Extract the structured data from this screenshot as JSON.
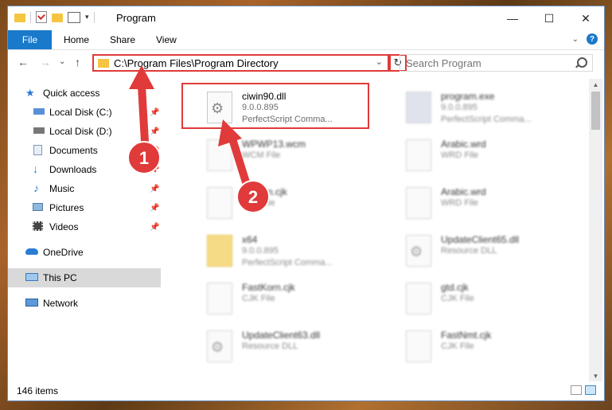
{
  "window": {
    "title": "Program"
  },
  "window_controls": {
    "minimize": "—",
    "maximize": "☐",
    "close": "✕"
  },
  "ribbon": {
    "file": "File",
    "home": "Home",
    "share": "Share",
    "view": "View"
  },
  "nav": {
    "back": "←",
    "forward": "→",
    "recent": "⌄",
    "up": "↑",
    "refresh": "↻",
    "chevron": "⌄"
  },
  "address": {
    "path": "C:\\Program Files\\Program Directory"
  },
  "search": {
    "placeholder": "Search Program"
  },
  "sidebar": {
    "items": [
      {
        "label": "Quick access",
        "icon": "star-icon"
      },
      {
        "label": "Local Disk (C:)",
        "icon": "drive-icon"
      },
      {
        "label": "Local Disk (D:)",
        "icon": "drive-icon"
      },
      {
        "label": "Documents",
        "icon": "documents-icon"
      },
      {
        "label": "Downloads",
        "icon": "downloads-icon"
      },
      {
        "label": "Music",
        "icon": "music-icon"
      },
      {
        "label": "Pictures",
        "icon": "pictures-icon"
      },
      {
        "label": "Videos",
        "icon": "videos-icon"
      },
      {
        "label": "OneDrive",
        "icon": "cloud-icon"
      },
      {
        "label": "This PC",
        "icon": "computer-icon"
      },
      {
        "label": "Network",
        "icon": "network-icon"
      }
    ]
  },
  "files": [
    {
      "name": "ciwin90.dll",
      "line1": "9.0.0.895",
      "line2": "PerfectScript Comma...",
      "icon": "dll-file-icon"
    },
    {
      "name": "program.exe",
      "line1": "9.0.0.895",
      "line2": "PerfectScript Comma...",
      "icon": "exe-file-icon"
    },
    {
      "name": "WPWP13.wcm",
      "line1": "WCM File",
      "line2": "",
      "icon": "generic-file-icon"
    },
    {
      "name": "Arabic.wrd",
      "line1": "WRD File",
      "line2": "",
      "icon": "generic-file-icon"
    },
    {
      "name": "Korean.cjk",
      "line1": "CJK File",
      "line2": "",
      "icon": "generic-file-icon"
    },
    {
      "name": "Arabic.wrd",
      "line1": "WRD File",
      "line2": "",
      "icon": "generic-file-icon"
    },
    {
      "name": "x64",
      "line1": "9.0.0.895",
      "line2": "PerfectScript Comma...",
      "icon": "folder-file-icon"
    },
    {
      "name": "UpdateClient65.dll",
      "line1": "Resource DLL",
      "line2": "",
      "icon": "dll-file-icon"
    },
    {
      "name": "FastKorn.cjk",
      "line1": "CJK File",
      "line2": "",
      "icon": "generic-file-icon"
    },
    {
      "name": "gtd.cjk",
      "line1": "CJK File",
      "line2": "",
      "icon": "generic-file-icon"
    },
    {
      "name": "UpdateClient63.dll",
      "line1": "Resource DLL",
      "line2": "",
      "icon": "dll-file-icon"
    },
    {
      "name": "FastNmt.cjk",
      "line1": "CJK File",
      "line2": "",
      "icon": "generic-file-icon"
    }
  ],
  "status": {
    "count": "146 items"
  },
  "annotations": {
    "step1": "1",
    "step2": "2",
    "color": "#e03a3a"
  }
}
